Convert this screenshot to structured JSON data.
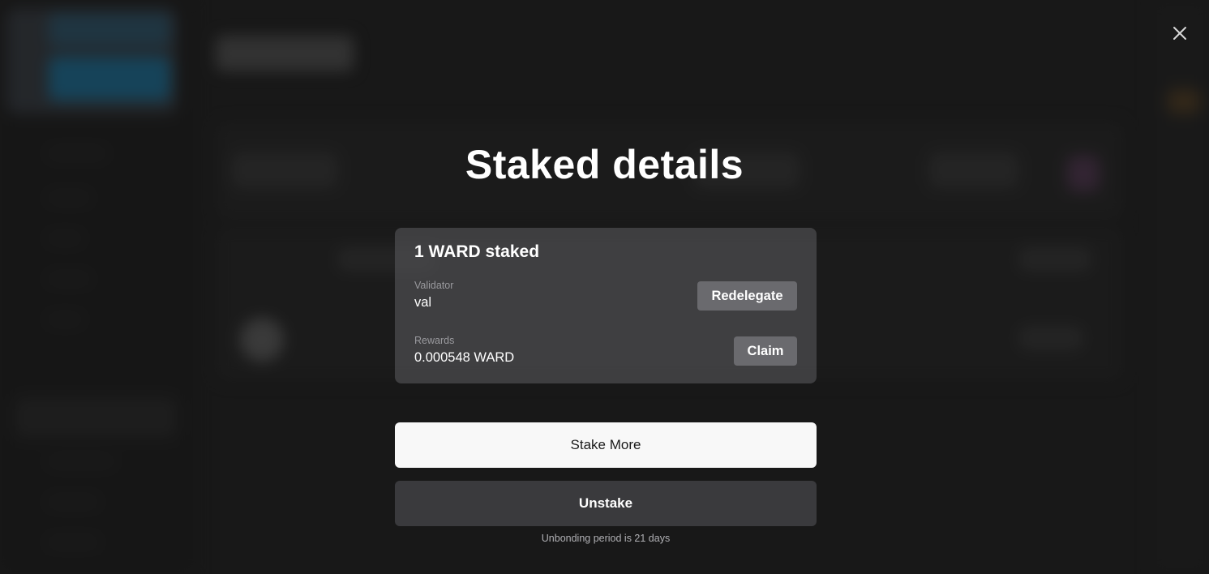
{
  "modal": {
    "title": "Staked details",
    "close_icon": "close-icon"
  },
  "stake_card": {
    "heading": "1 WARD staked",
    "validator": {
      "label": "Validator",
      "value": "val",
      "action_label": "Redelegate"
    },
    "rewards": {
      "label": "Rewards",
      "value": "0.000548 WARD",
      "action_label": "Claim"
    }
  },
  "actions": {
    "stake_more_label": "Stake More",
    "unstake_label": "Unstake",
    "unbonding_note": "Unbonding period is 21 days"
  },
  "colors": {
    "overlay": "#121212",
    "card_bg": "#4a4a4e",
    "primary_button_bg": "#f8f8f8",
    "secondary_button_bg": "#3a3a3d",
    "card_button_bg": "#6a6a6e"
  }
}
